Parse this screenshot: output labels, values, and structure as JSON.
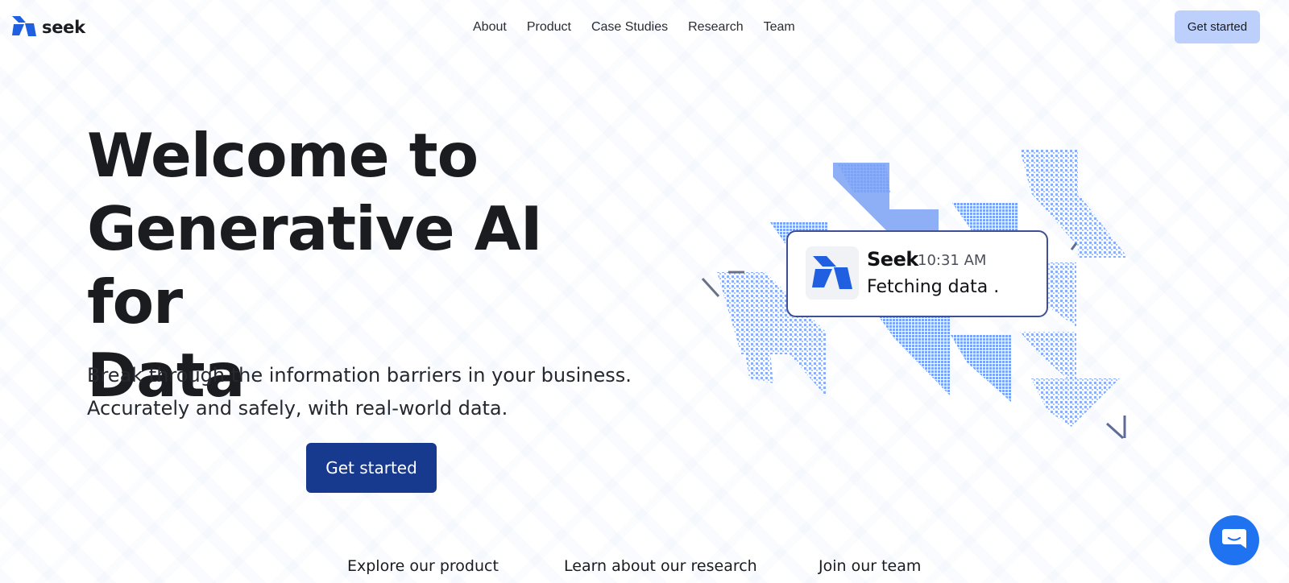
{
  "brand": {
    "name": "seek",
    "logo_icon": "seek-logo-icon"
  },
  "nav": {
    "items": [
      "About",
      "Product",
      "Case Studies",
      "Research",
      "Team"
    ]
  },
  "header": {
    "cta_label": "Get started"
  },
  "hero": {
    "title_lines": [
      "Welcome to",
      "Generative AI for",
      "Data"
    ],
    "subtitle_lines": [
      "Break through the information barriers in your business.",
      "Accurately and safely, with real-world data."
    ],
    "cta_label": "Get started"
  },
  "notification": {
    "sender": "Seek",
    "time": "10:31 AM",
    "message": "Fetching data .",
    "avatar_icon": "seek-logo-icon"
  },
  "bottom_links": [
    "Explore our product",
    "Learn about our research",
    "Join our team"
  ],
  "chat": {
    "icon": "chat-bubble-icon"
  },
  "colors": {
    "brand_blue": "#1f5fe0",
    "cta_dark": "#173a8e",
    "cta_light": "#bcd0fb",
    "illustration_blue": "#7fa3f3",
    "card_border": "#3f4f93"
  }
}
